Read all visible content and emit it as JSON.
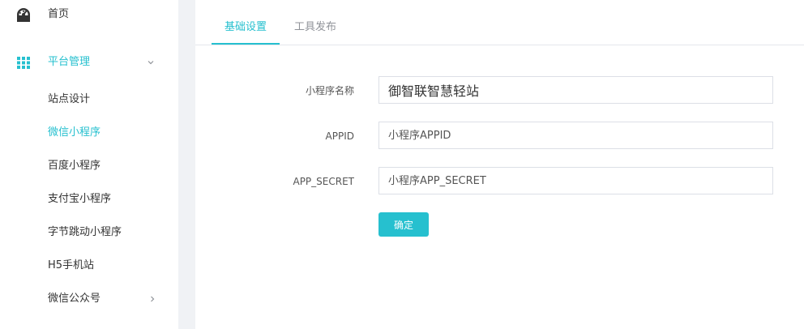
{
  "sidebar": {
    "home": {
      "label": "首页",
      "icon": "dashboard-icon"
    },
    "group": {
      "label": "平台管理",
      "icon": "grid-icon",
      "expanded": true
    },
    "items": [
      {
        "label": "站点设计",
        "active": false
      },
      {
        "label": "微信小程序",
        "active": true
      },
      {
        "label": "百度小程序",
        "active": false
      },
      {
        "label": "支付宝小程序",
        "active": false
      },
      {
        "label": "字节跳动小程序",
        "active": false
      },
      {
        "label": "H5手机站",
        "active": false
      },
      {
        "label": "微信公众号",
        "active": false,
        "has_submenu": true
      }
    ]
  },
  "tabs": [
    {
      "label": "基础设置",
      "active": true
    },
    {
      "label": "工具发布",
      "active": false
    }
  ],
  "form": {
    "name": {
      "label": "小程序名称",
      "value": "御智联智慧轻站"
    },
    "appid": {
      "label": "APPID",
      "placeholder": "小程序APPID"
    },
    "secret": {
      "label": "APP_SECRET",
      "placeholder": "小程序APP_SECRET"
    },
    "submit_label": "确定"
  },
  "colors": {
    "accent": "#26c0cf",
    "background": "#f0f2f5",
    "panel": "#ffffff"
  }
}
